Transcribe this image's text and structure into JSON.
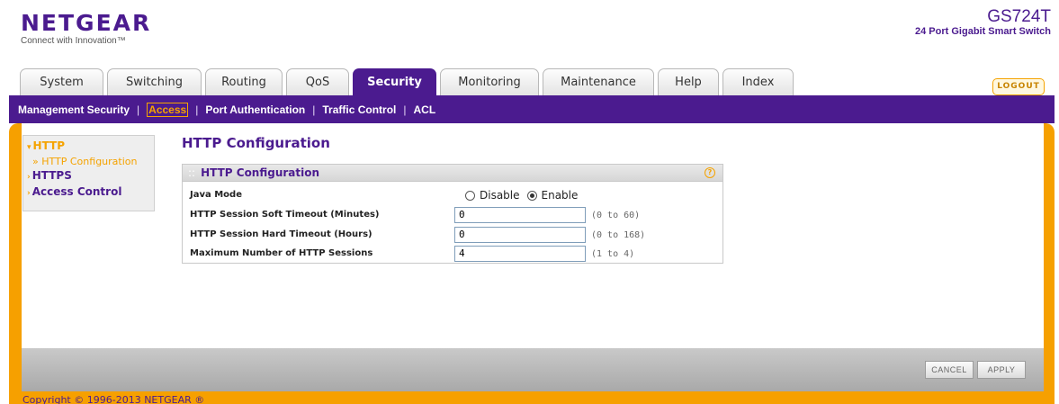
{
  "header": {
    "logo_text": "NETGEAR",
    "logo_tagline": "Connect with Innovation™",
    "product_model": "GS724T",
    "product_desc": "24 Port Gigabit Smart Switch"
  },
  "tabs": [
    {
      "label": "System",
      "active": false
    },
    {
      "label": "Switching",
      "active": false
    },
    {
      "label": "Routing",
      "active": false
    },
    {
      "label": "QoS",
      "active": false
    },
    {
      "label": "Security",
      "active": true
    },
    {
      "label": "Monitoring",
      "active": false
    },
    {
      "label": "Maintenance",
      "active": false
    },
    {
      "label": "Help",
      "active": false
    },
    {
      "label": "Index",
      "active": false
    }
  ],
  "logout_label": "LOGOUT",
  "subnav": {
    "items": [
      {
        "label": "Management Security",
        "active": false
      },
      {
        "label": "Access",
        "active": true
      },
      {
        "label": "Port Authentication",
        "active": false
      },
      {
        "label": "Traffic Control",
        "active": false
      },
      {
        "label": "ACL",
        "active": false
      }
    ]
  },
  "leftnav": {
    "http": "HTTP",
    "http_config": "HTTP Configuration",
    "https": "HTTPS",
    "access_control": "Access Control"
  },
  "page_title": "HTTP Configuration",
  "panel": {
    "title": "HTTP Configuration",
    "help": "?",
    "java_mode": {
      "label": "Java Mode",
      "options": [
        "Disable",
        "Enable"
      ],
      "selected": "Enable"
    },
    "soft_timeout": {
      "label": "HTTP Session Soft Timeout (Minutes)",
      "value": "0",
      "range": "(0 to 60)"
    },
    "hard_timeout": {
      "label": "HTTP Session Hard Timeout (Hours)",
      "value": "0",
      "range": "(0 to 168)"
    },
    "max_sessions": {
      "label": "Maximum Number of HTTP Sessions",
      "value": "4",
      "range": "(1 to 4)"
    }
  },
  "buttons": {
    "cancel": "CANCEL",
    "apply": "APPLY"
  },
  "footer": "Copyright © 1996-2013 NETGEAR ®",
  "colors": {
    "brand_purple": "#4b1b8f",
    "accent_orange": "#f6a000"
  }
}
